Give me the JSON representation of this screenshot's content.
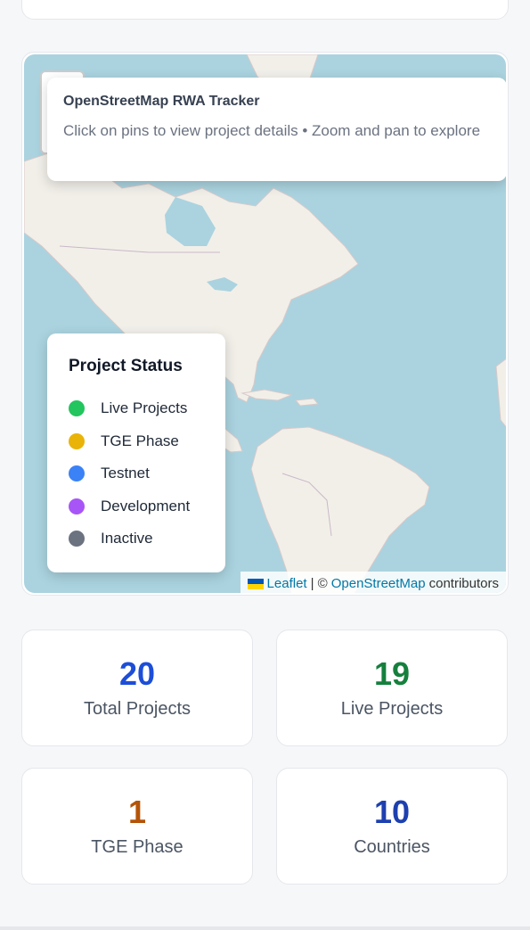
{
  "map": {
    "info_title": "OpenStreetMap RWA Tracker",
    "info_subtitle": "Click on pins to view project details • Zoom and pan to explore",
    "legend": {
      "title": "Project Status",
      "items": [
        {
          "label": "Live Projects",
          "color": "#22c55e"
        },
        {
          "label": "TGE Phase",
          "color": "#eab308"
        },
        {
          "label": "Testnet",
          "color": "#3b82f6"
        },
        {
          "label": "Development",
          "color": "#a855f7"
        },
        {
          "label": "Inactive",
          "color": "#6b7280"
        }
      ]
    },
    "attribution": {
      "leaflet": "Leaflet",
      "separator": "| ©",
      "osm": "OpenStreetMap",
      "suffix": "contributors"
    }
  },
  "stats": [
    {
      "value": "20",
      "label": "Total Projects",
      "color": "#1d4ed8"
    },
    {
      "value": "19",
      "label": "Live Projects",
      "color": "#15803d"
    },
    {
      "value": "1",
      "label": "TGE Phase",
      "color": "#b45309"
    },
    {
      "value": "10",
      "label": "Countries",
      "color": "#1e40af"
    }
  ]
}
